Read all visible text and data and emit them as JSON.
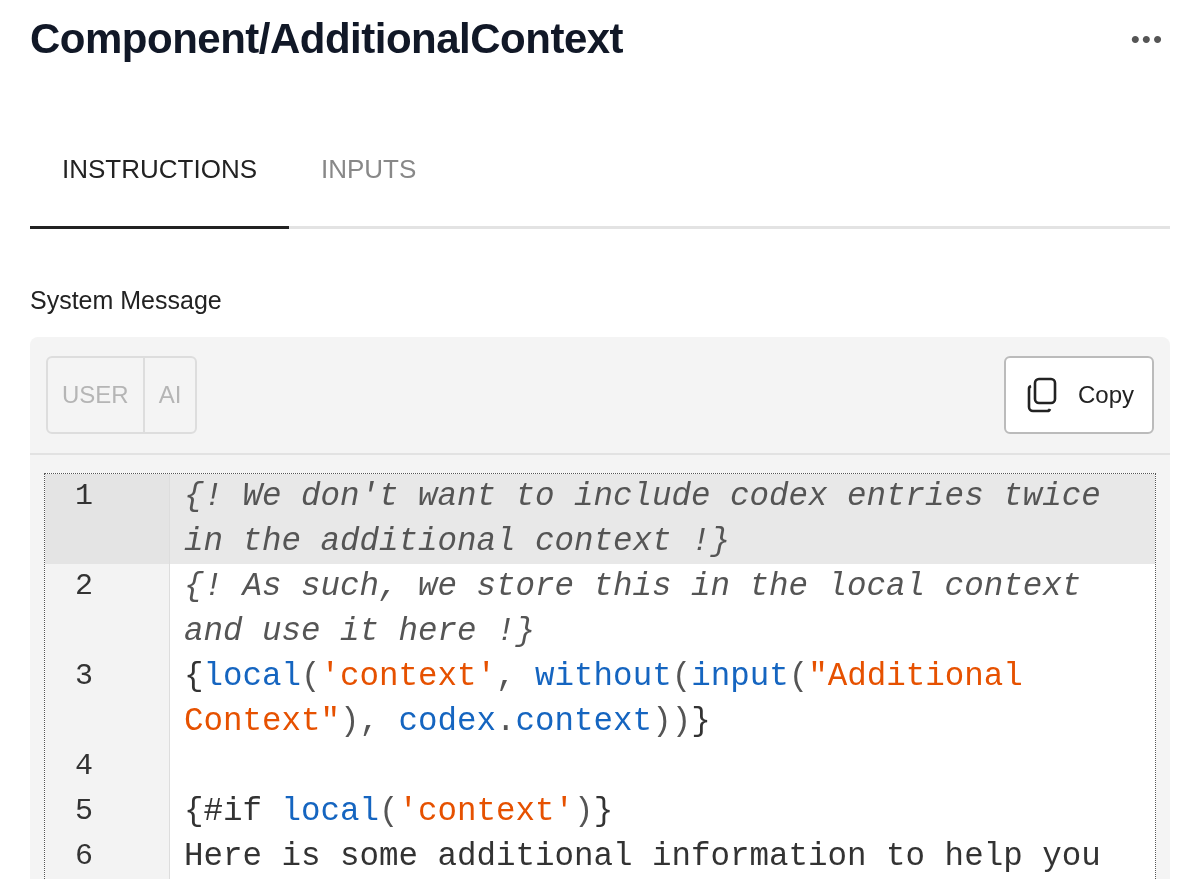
{
  "header": {
    "title": "Component/AdditionalContext",
    "menu": "•••"
  },
  "tabs": [
    {
      "label": "INSTRUCTIONS",
      "selected": true
    },
    {
      "label": "INPUTS",
      "selected": false
    }
  ],
  "field_label": "System Message",
  "role_toggle": [
    {
      "label": "USER",
      "disabled": true
    },
    {
      "label": "AI",
      "disabled": true
    }
  ],
  "copy_button": {
    "label": "Copy"
  },
  "editor": {
    "lines": [
      {
        "number": "1",
        "active": true,
        "tokens": [
          {
            "kind": "comment",
            "text": "{! We don't want to include codex entries twice in the additional context !}"
          }
        ]
      },
      {
        "number": "2",
        "active": false,
        "tokens": [
          {
            "kind": "comment",
            "text": "{! As such, we store this in the local context and use it here !}"
          }
        ]
      },
      {
        "number": "3",
        "active": false,
        "tokens": [
          {
            "kind": "plain",
            "text": "{"
          },
          {
            "kind": "func",
            "text": "local"
          },
          {
            "kind": "punct",
            "text": "("
          },
          {
            "kind": "string",
            "text": "'context'"
          },
          {
            "kind": "punct",
            "text": ", "
          },
          {
            "kind": "func",
            "text": "without"
          },
          {
            "kind": "punct",
            "text": "("
          },
          {
            "kind": "func",
            "text": "input"
          },
          {
            "kind": "punct",
            "text": "("
          },
          {
            "kind": "string",
            "text": "\"Additional Context\""
          },
          {
            "kind": "punct",
            "text": "), "
          },
          {
            "kind": "func",
            "text": "codex"
          },
          {
            "kind": "punct",
            "text": "."
          },
          {
            "kind": "func",
            "text": "context"
          },
          {
            "kind": "punct",
            "text": "))"
          },
          {
            "kind": "plain",
            "text": "}"
          }
        ]
      },
      {
        "number": "4",
        "active": false
      },
      {
        "number": "5",
        "active": false,
        "tokens": [
          {
            "kind": "plain",
            "text": "{#if "
          },
          {
            "kind": "func",
            "text": "local"
          },
          {
            "kind": "punct",
            "text": "("
          },
          {
            "kind": "string",
            "text": "'context'"
          },
          {
            "kind": "punct",
            "text": ")"
          },
          {
            "kind": "plain",
            "text": "}"
          }
        ]
      },
      {
        "number": "6",
        "active": false,
        "tokens": [
          {
            "kind": "plain",
            "text": "Here is some additional information to help you"
          }
        ]
      }
    ]
  }
}
